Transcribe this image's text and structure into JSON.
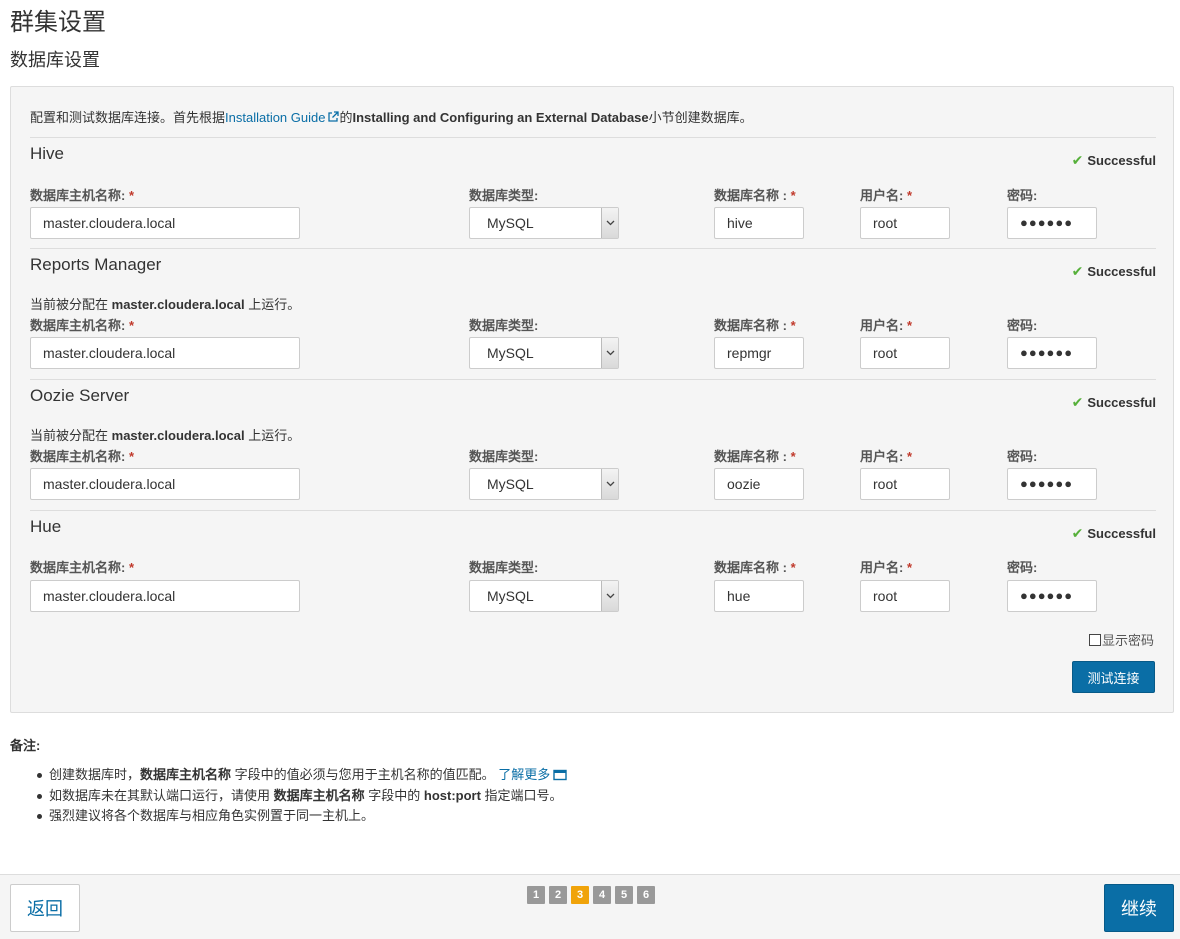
{
  "page": {
    "title": "群集设置",
    "subtitle": "数据库设置"
  },
  "intro": {
    "before_link": "配置和测试数据库连接。首先根据",
    "link_text": "Installation Guide",
    "middle": "的",
    "bold_text": "Installing and Configuring an External Database",
    "after": "小节创建数据库。"
  },
  "field_labels": {
    "host": "数据库主机名称:",
    "type": "数据库类型:",
    "db_name": "数据库名称 :",
    "user": "用户名:",
    "password": "密码:",
    "required_mark": "*"
  },
  "assigned_note": {
    "prefix": "当前被分配在",
    "host": "master.cloudera.local",
    "suffix": "上运行。"
  },
  "status_icon": "check-icon",
  "status_color": "#56b03a",
  "sections": [
    {
      "title": "Hive",
      "status": "Successful",
      "host": "master.cloudera.local",
      "db_type": "MySQL",
      "db_name": "hive",
      "user": "root",
      "password": "●●●●●●"
    },
    {
      "title": "Reports Manager",
      "status": "Successful",
      "host": "master.cloudera.local",
      "db_type": "MySQL",
      "db_name": "repmgr",
      "user": "root",
      "password": "●●●●●●"
    },
    {
      "title": "Oozie Server",
      "status": "Successful",
      "host": "master.cloudera.local",
      "db_type": "MySQL",
      "db_name": "oozie",
      "user": "root",
      "password": "●●●●●●"
    },
    {
      "title": "Hue",
      "status": "Successful",
      "host": "master.cloudera.local",
      "db_type": "MySQL",
      "db_name": "hue",
      "user": "root",
      "password": "●●●●●●"
    }
  ],
  "show_password": {
    "label": "显示密码",
    "checked": false
  },
  "test_button": "测试连接",
  "notes": {
    "title": "备注:",
    "items": [
      {
        "a": "创建数据库时，",
        "b": "数据库主机名称",
        "c": " 字段中的值必须与您用于主机名称的值匹配。",
        "link": "了解更多"
      },
      {
        "a": "如数据库未在其默认端口运行，请使用 ",
        "b": "数据库主机名称",
        "c": " 字段中的 ",
        "d": "host:port",
        "e": " 指定端口号。"
      },
      {
        "a": "强烈建议将各个数据库与相应角色实例置于同一主机上。"
      }
    ]
  },
  "footer": {
    "back": "返回",
    "next": "继续",
    "steps": [
      "1",
      "2",
      "3",
      "4",
      "5",
      "6"
    ],
    "current_step": "3"
  },
  "colors": {
    "accent": "#0a6ea6",
    "active_step": "#f0a30a",
    "inactive_step": "#999999",
    "required": "#c0392b"
  }
}
